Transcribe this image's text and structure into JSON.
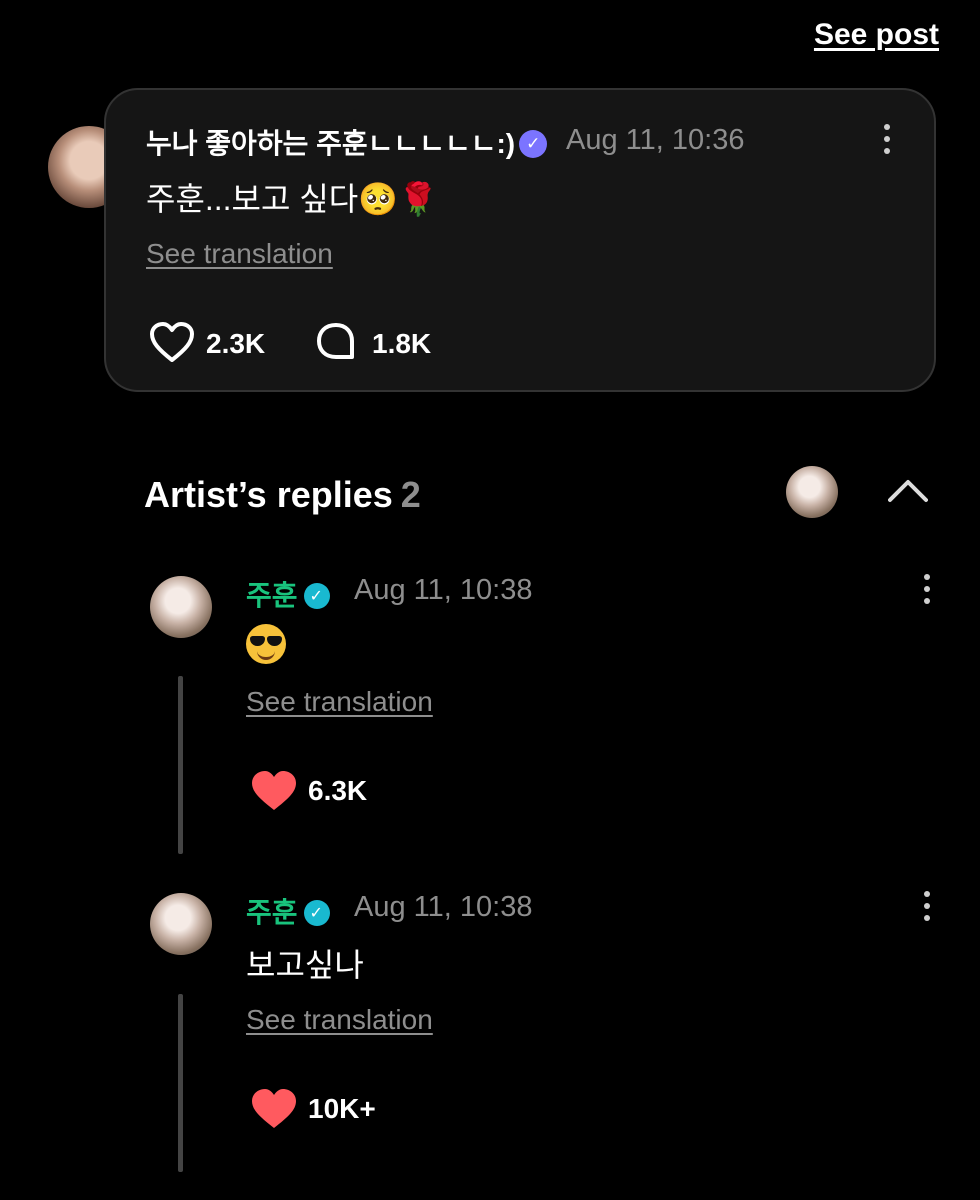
{
  "header": {
    "see_post": "See post"
  },
  "post": {
    "author": "누나 좋아하는 주훈ㄴㄴㄴㄴㄴ:)",
    "time": "Aug 11, 10:36",
    "text": "주훈...보고 싶다🥺🌹",
    "see_translation": "See translation",
    "likes": "2.3K",
    "comments": "1.8K"
  },
  "artist_replies": {
    "title": "Artist’s replies",
    "count": "2",
    "replies": [
      {
        "name": "주훈",
        "time": "Aug 11, 10:38",
        "text": "😎",
        "see_translation": "See translation",
        "likes": "6.3K"
      },
      {
        "name": "주훈",
        "time": "Aug 11, 10:38",
        "text": "보고싶나",
        "see_translation": "See translation",
        "likes": "10K+"
      }
    ]
  },
  "colors": {
    "background": "#000000",
    "artist_name": "#19c37d",
    "heart": "#ff5a5f",
    "muted": "#8e8e8e"
  },
  "icons": [
    "heart-outline-icon",
    "comment-bubble-icon",
    "more-vert-icon",
    "chevron-up-icon",
    "heart-filled-icon",
    "verified-badge-icon"
  ]
}
